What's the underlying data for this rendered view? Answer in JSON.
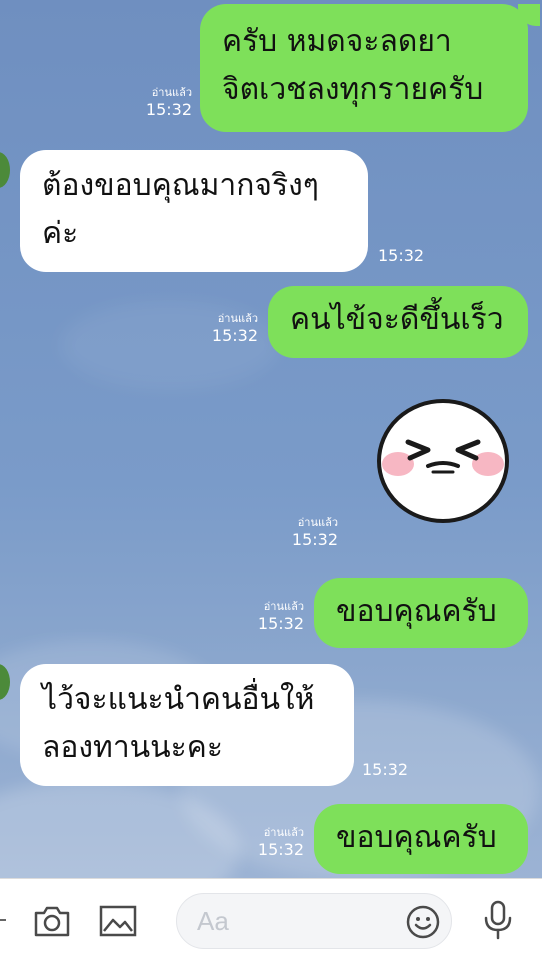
{
  "messages": [
    {
      "id": "m1",
      "side": "out",
      "lines": [
        "ครับ หมดจะลดยา",
        "จิตเวชลงทุกรายครับ"
      ],
      "read": "อ่านแล้ว",
      "time": "15:32"
    },
    {
      "id": "m2",
      "side": "in",
      "lines": [
        "ต้องขอบคุณมากจริงๆ",
        "ค่ะ"
      ],
      "time": "15:32"
    },
    {
      "id": "m3",
      "side": "out",
      "lines": [
        "คนไข้จะดีขึ้นเร็ว"
      ],
      "read": "อ่านแล้ว",
      "time": "15:32"
    },
    {
      "id": "m4",
      "side": "out",
      "type": "sticker",
      "sticker": "laughing-face-sticker",
      "read": "อ่านแล้ว",
      "time": "15:32"
    },
    {
      "id": "m5",
      "side": "out",
      "lines": [
        "ขอบคุณครับ"
      ],
      "read": "อ่านแล้ว",
      "time": "15:32"
    },
    {
      "id": "m6",
      "side": "in",
      "lines": [
        "ไว้จะแนะนำคนอื่นให้",
        "ลองทานนะคะ"
      ],
      "time": "15:32"
    },
    {
      "id": "m7",
      "side": "out",
      "lines": [
        "ขอบคุณครับ"
      ],
      "read": "อ่านแล้ว",
      "time": "15:32"
    }
  ],
  "input": {
    "placeholder": "Aa"
  },
  "toolbar": {
    "icons": [
      "camera-icon",
      "image-icon",
      "emoji-icon",
      "microphone-icon"
    ]
  },
  "colors": {
    "outgoing_bubble": "#7ee05a",
    "incoming_bubble": "#ffffff",
    "background": "#7a9bc6"
  }
}
